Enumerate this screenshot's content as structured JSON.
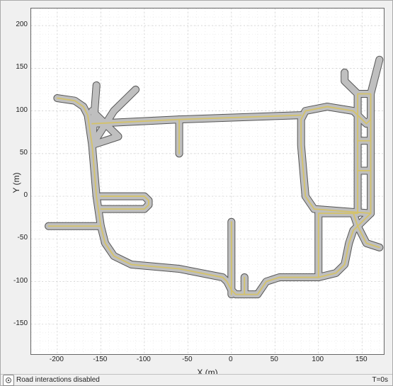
{
  "chart_data": {
    "type": "map",
    "title": "",
    "xlabel": "X (m)",
    "ylabel": "Y (m)",
    "xlim": [
      -230,
      175
    ],
    "ylim": [
      -185,
      220
    ],
    "xticks": [
      -200,
      -150,
      -100,
      -50,
      0,
      50,
      100,
      150
    ],
    "yticks": [
      -150,
      -100,
      -50,
      0,
      50,
      100,
      150,
      200
    ],
    "grid": true,
    "roads": [
      {
        "pts": [
          [
            -200,
            115
          ],
          [
            -180,
            112
          ],
          [
            -170,
            105
          ],
          [
            -165,
            95
          ],
          [
            -160,
            60
          ]
        ],
        "lane": true
      },
      {
        "pts": [
          [
            -160,
            60
          ],
          [
            -155,
            130
          ]
        ],
        "lane": false
      },
      {
        "pts": [
          [
            -160,
            60
          ],
          [
            -135,
            100
          ],
          [
            -120,
            115
          ],
          [
            -110,
            125
          ]
        ],
        "lane": false
      },
      {
        "pts": [
          [
            -160,
            100
          ],
          [
            -130,
            70
          ],
          [
            -160,
            60
          ]
        ],
        "lane": false
      },
      {
        "pts": [
          [
            -160,
            60
          ],
          [
            -155,
            0
          ],
          [
            -150,
            -35
          ],
          [
            -145,
            -55
          ],
          [
            -135,
            -70
          ],
          [
            -115,
            -80
          ],
          [
            -60,
            -85
          ],
          [
            -10,
            -95
          ],
          [
            -5,
            -100
          ],
          [
            0,
            -110
          ],
          [
            5,
            -115
          ],
          [
            30,
            -115
          ],
          [
            40,
            -100
          ],
          [
            55,
            -95
          ],
          [
            100,
            -95
          ],
          [
            120,
            -90
          ],
          [
            130,
            -80
          ],
          [
            135,
            -55
          ],
          [
            140,
            -40
          ],
          [
            150,
            -30
          ],
          [
            160,
            -20
          ]
        ],
        "lane": true
      },
      {
        "pts": [
          [
            160,
            -20
          ],
          [
            95,
            -15
          ],
          [
            85,
            0
          ],
          [
            80,
            60
          ],
          [
            80,
            90
          ],
          [
            85,
            100
          ],
          [
            110,
            105
          ],
          [
            140,
            100
          ],
          [
            150,
            90
          ],
          [
            155,
            85
          ],
          [
            160,
            90
          ]
        ],
        "lane": true
      },
      {
        "pts": [
          [
            160,
            -20
          ],
          [
            160,
            65
          ]
        ],
        "lane": true
      },
      {
        "pts": [
          [
            160,
            65
          ],
          [
            160,
            120
          ],
          [
            145,
            120
          ],
          [
            145,
            -20
          ],
          [
            100,
            -20
          ]
        ],
        "lane": true
      },
      {
        "pts": [
          [
            145,
            65
          ],
          [
            160,
            65
          ]
        ],
        "lane": true
      },
      {
        "pts": [
          [
            145,
            30
          ],
          [
            160,
            30
          ]
        ],
        "lane": true
      },
      {
        "pts": [
          [
            140,
            -20
          ],
          [
            145,
            -35
          ],
          [
            155,
            -55
          ],
          [
            170,
            -60
          ]
        ],
        "lane": true
      },
      {
        "pts": [
          [
            160,
            120
          ],
          [
            170,
            160
          ]
        ],
        "lane": false
      },
      {
        "pts": [
          [
            145,
            120
          ],
          [
            130,
            135
          ],
          [
            130,
            145
          ]
        ],
        "lane": false
      },
      {
        "pts": [
          [
            80,
            95
          ],
          [
            -60,
            90
          ],
          [
            -160,
            85
          ]
        ],
        "lane": true
      },
      {
        "pts": [
          [
            -60,
            90
          ],
          [
            -60,
            50
          ]
        ],
        "lane": true
      },
      {
        "pts": [
          [
            -210,
            -35
          ],
          [
            -150,
            -35
          ]
        ],
        "lane": true
      },
      {
        "pts": [
          [
            -150,
            -15
          ],
          [
            -100,
            -15
          ],
          [
            -95,
            -10
          ],
          [
            -95,
            -5
          ],
          [
            -100,
            0
          ],
          [
            -150,
            0
          ]
        ],
        "lane": true
      },
      {
        "pts": [
          [
            0,
            -115
          ],
          [
            0,
            -30
          ]
        ],
        "lane": true
      },
      {
        "pts": [
          [
            15,
            -115
          ],
          [
            15,
            -95
          ]
        ],
        "lane": true
      },
      {
        "pts": [
          [
            100,
            -95
          ],
          [
            100,
            -20
          ]
        ],
        "lane": true
      }
    ]
  },
  "status": {
    "icon": "gear-icon",
    "text": "Road interactions disabled",
    "time": "T=0s"
  }
}
